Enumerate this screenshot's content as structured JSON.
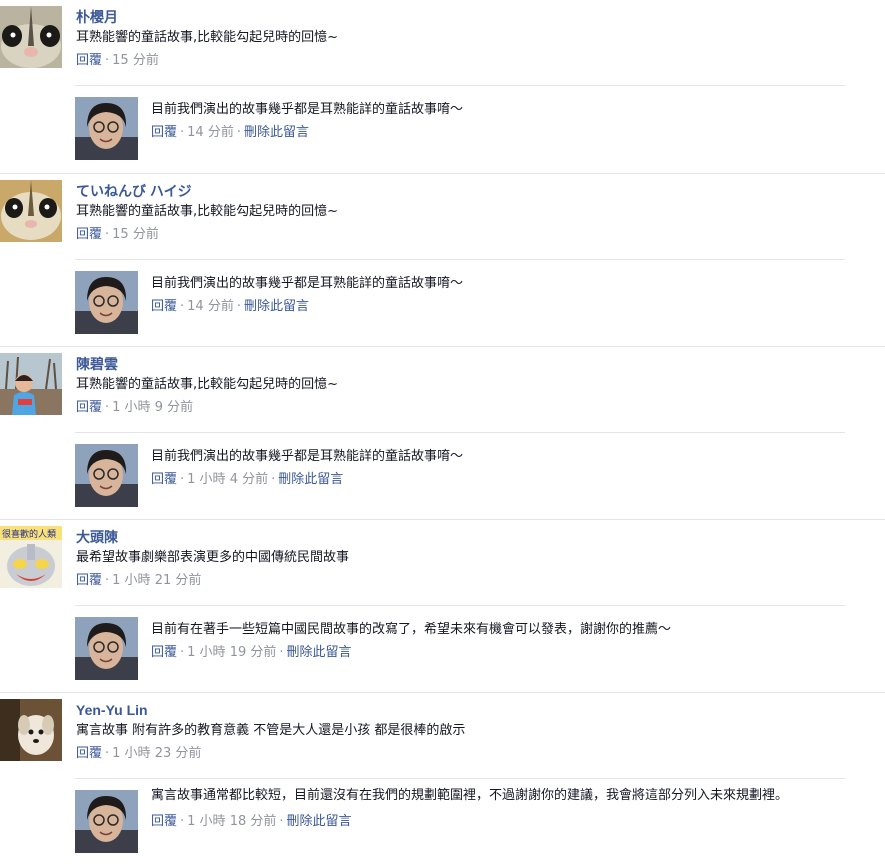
{
  "reply_action": "回覆",
  "delete_action": "刪除此留言",
  "separator": "·",
  "threads": [
    {
      "author": "朴櫻月",
      "avatar": "sugar-glider-avatar",
      "text": "耳熟能響的童話故事,比較能勾起兒時的回憶~",
      "time": "15 分前",
      "reply": {
        "text": "目前我們演出的故事幾乎都是耳熟能詳的童話故事唷～",
        "time": "14 分前"
      }
    },
    {
      "author": "ていねんび ハイジ",
      "avatar": "sugar-glider-avatar",
      "text": "耳熟能響的童話故事,比較能勾起兒時的回憶~",
      "time": "15 分前",
      "reply": {
        "text": "目前我們演出的故事幾乎都是耳熟能詳的童話故事唷～",
        "time": "14 分前"
      }
    },
    {
      "author": "陳碧雲",
      "avatar": "child-photo-avatar",
      "text": "耳熟能響的童話故事,比較能勾起兒時的回憶~",
      "time": "1 小時 9 分前",
      "reply": {
        "text": "目前我們演出的故事幾乎都是耳熟能詳的童話故事唷～",
        "time": "1 小時 4 分前"
      }
    },
    {
      "author": "大頭陳",
      "avatar": "ultraman-avatar",
      "avatar_caption": "很喜歡的人類",
      "text": "最希望故事劇樂部表演更多的中國傳統民間故事",
      "time": "1 小時 21 分前",
      "reply": {
        "text": "目前有在著手一些短篇中國民間故事的改寫了，希望未來有機會可以發表，謝謝你的推薦～",
        "time": "1 小時 19 分前"
      }
    },
    {
      "author": "Yen-Yu Lin",
      "avatar": "dog-photo-avatar",
      "text": "寓言故事 附有許多的教育意義 不管是大人還是小孩 都是很棒的啟示",
      "time": "1 小時 23 分前",
      "reply": {
        "text": "寓言故事通常都比較短，目前還沒有在我們的規劃範圍裡，不過謝謝你的建議，我會將這部分列入未來規劃裡。",
        "time": "1 小時 18 分前"
      }
    }
  ],
  "colors": {
    "link": "#3b5998",
    "meta": "#90949c",
    "divider": "#e3e5ea"
  }
}
